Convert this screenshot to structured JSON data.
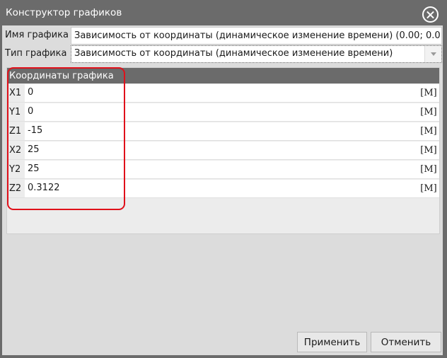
{
  "window": {
    "title": "Конструктор графиков"
  },
  "fields": {
    "name_label": "Имя графика",
    "name_value": "Зависимость от координаты (динамическое изменение времени) (0.00; 0.0",
    "type_label": "Тип графика",
    "type_value": "Зависимость от координаты (динамическое изменение времени)"
  },
  "coordinates": {
    "header": "Координаты графика",
    "rows": [
      {
        "label": "X1",
        "value": "0",
        "unit": "[M]"
      },
      {
        "label": "Y1",
        "value": "0",
        "unit": "[M]"
      },
      {
        "label": "Z1",
        "value": "-15",
        "unit": "[M]"
      },
      {
        "label": "X2",
        "value": "25",
        "unit": "[M]"
      },
      {
        "label": "Y2",
        "value": "25",
        "unit": "[M]"
      },
      {
        "label": "Z2",
        "value": "0.3122",
        "unit": "[M]"
      }
    ]
  },
  "buttons": {
    "apply": "Применить",
    "cancel": "Отменить"
  },
  "colors": {
    "highlight": "#e0101a",
    "titlebar": "#6b6b6b"
  }
}
